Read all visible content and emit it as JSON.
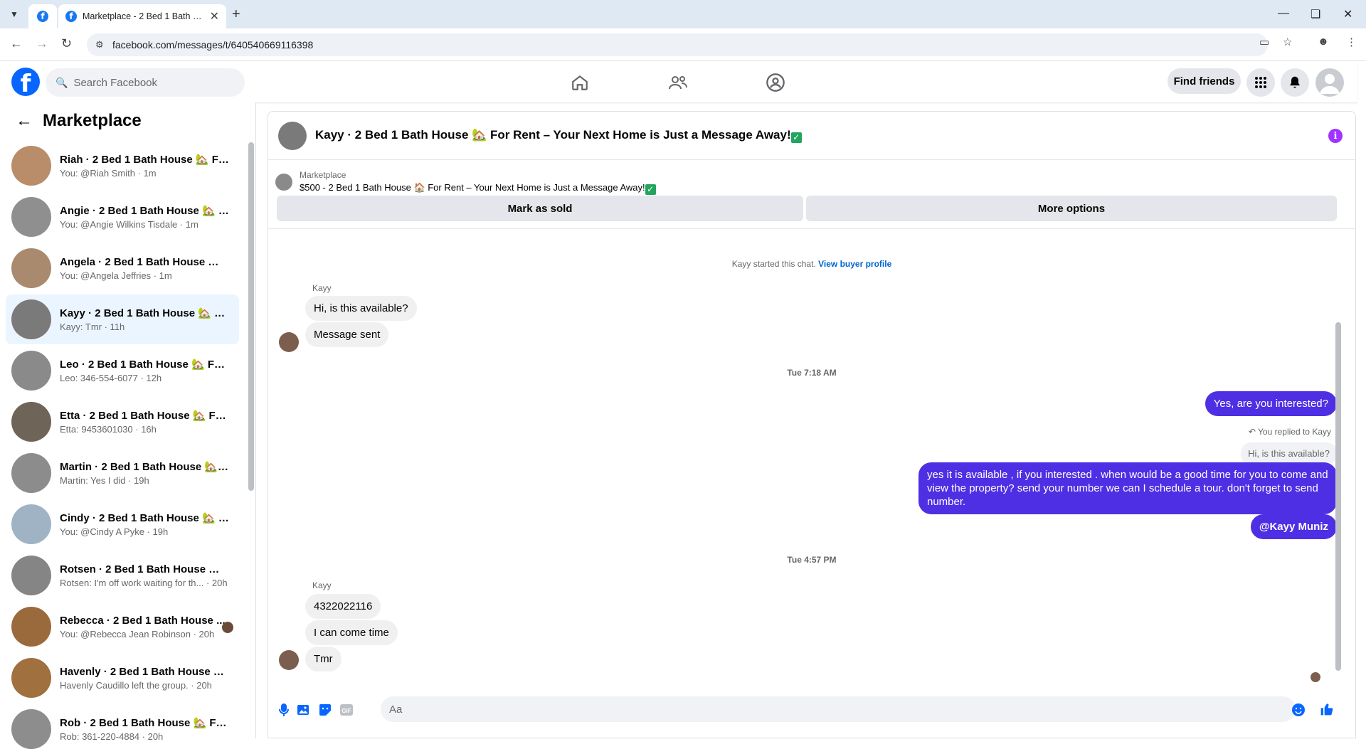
{
  "browser": {
    "tab_title": "Marketplace - 2 Bed 1 Bath Hou",
    "url": "facebook.com/messages/t/640540669116398"
  },
  "header": {
    "search_placeholder": "Search Facebook",
    "find_friends": "Find friends"
  },
  "sidebar": {
    "title": "Marketplace",
    "conversations": [
      {
        "name": "Riah · 2 Bed 1 Bath House 🏡 Fo...",
        "sub": "You: @Riah Smith · 1m",
        "color": "#b98d6a"
      },
      {
        "name": "Angie · 2 Bed 1 Bath House 🏡 F...",
        "sub": "You: @Angie Wilkins Tisdale · 1m",
        "color": "#8f8f8f"
      },
      {
        "name": "Angela · 2 Bed 1 Bath House 🏡 ...",
        "sub": "You: @Angela Jeffries · 1m",
        "color": "#a98a6e"
      },
      {
        "name": "Kayy · 2 Bed 1 Bath House 🏡 Fo...",
        "sub": "Kayy: Tmr · 11h",
        "color": "#7a7a7a"
      },
      {
        "name": "Leo · 2 Bed 1 Bath House 🏡 For ...",
        "sub": "Leo: 346-554-6077 · 12h",
        "color": "#8a8a8a"
      },
      {
        "name": "Etta · 2 Bed 1 Bath House 🏡 For...",
        "sub": "Etta: 9453601030 · 16h",
        "color": "#6f6458"
      },
      {
        "name": "Martin · 2 Bed 1 Bath House 🏡 ...",
        "sub": "Martin: Yes I did · 19h",
        "color": "#8c8c8c"
      },
      {
        "name": "Cindy · 2 Bed 1 Bath House 🏡 F...",
        "sub": "You: @Cindy A Pyke · 19h",
        "color": "#9fb3c4"
      },
      {
        "name": "Rotsen · 2 Bed 1 Bath House 🏡 ...",
        "sub": "Rotsen: I'm off work waiting for th... · 20h",
        "color": "#858585"
      },
      {
        "name": "Rebecca · 2 Bed 1 Bath House ...",
        "sub": "You: @Rebecca Jean Robinson · 20h",
        "color": "#9b6a3c"
      },
      {
        "name": "Havenly · 2 Bed 1 Bath House 🏡 ...",
        "sub": "Havenly Caudillo left the group. · 20h",
        "color": "#a0703e"
      },
      {
        "name": "Rob · 2 Bed 1 Bath House 🏡 For...",
        "sub": "Rob: 361-220-4884 · 20h",
        "color": "#8d8d8d"
      }
    ]
  },
  "chat": {
    "title": "Kayy · 2 Bed 1 Bath House 🏡 For Rent – Your Next Home is Just a Message Away!",
    "listing_label": "Marketplace",
    "listing_title": "$500 - 2 Bed 1 Bath House 🏠 For Rent – Your Next Home is Just a Message Away!",
    "mark_sold": "Mark as sold",
    "more_options": "More options",
    "started_text": "Kayy started this chat.",
    "view_buyer": "View buyer profile",
    "sender_name": "Kayy",
    "msg_in_1": "Hi, is this available?",
    "msg_in_2": "Message sent",
    "ts_1": "Tue 7:18 AM",
    "msg_out_1": "Yes, are you interested?",
    "replied_to": "You replied to Kayy",
    "quoted": "Hi, is this available?",
    "msg_out_2": "yes it is available , if you interested . when would be  a good time for you to come and view the  property? send your number we can I schedule  a tour. don't forget to send  number.",
    "msg_out_3": "@Kayy Muniz",
    "ts_2": "Tue 4:57 PM",
    "sender_name_2": "Kayy",
    "msg_in_3": "4322022116",
    "msg_in_4": "I can come time",
    "msg_in_5": "Tmr",
    "composer_placeholder": "Aa"
  },
  "colors": {
    "fb_blue": "#0866ff",
    "outgoing": "#4f2fe4",
    "active_row": "#ebf5ff"
  }
}
